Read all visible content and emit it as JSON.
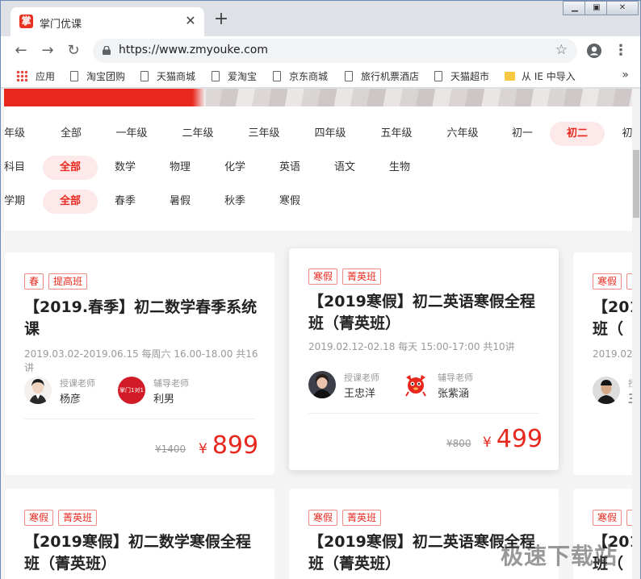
{
  "browser": {
    "tab_title": "掌门优课",
    "tab_logo_char": "掌",
    "url": "https://www.zmyouke.com",
    "bookmarks": {
      "apps": "应用",
      "items": [
        "淘宝团购",
        "天猫商城",
        "爱淘宝",
        "京东商城",
        "旅行机票酒店",
        "天猫超市"
      ],
      "import": "从 IE 中导入"
    }
  },
  "filters": {
    "grade": {
      "label": "年级",
      "options": [
        "全部",
        "一年级",
        "二年级",
        "三年级",
        "四年级",
        "五年级",
        "六年级",
        "初一",
        "初二",
        "初"
      ],
      "selected": "初二"
    },
    "subject": {
      "label": "科目",
      "options": [
        "全部",
        "数学",
        "物理",
        "化学",
        "英语",
        "语文",
        "生物"
      ],
      "selected": "全部"
    },
    "term": {
      "label": "学期",
      "options": [
        "全部",
        "春季",
        "暑假",
        "秋季",
        "寒假"
      ],
      "selected": "全部"
    }
  },
  "courses": [
    {
      "tags": [
        "春",
        "提高班"
      ],
      "title": "【2019.春季】初二数学春季系统课",
      "schedule": "2019.03.02-2019.06.15 每周六 16.00-18.00  共16讲",
      "lecturer_role": "授课老师",
      "lecturer": "杨彦",
      "tutor_role": "辅导老师",
      "tutor": "利男",
      "old_price": "¥1400",
      "currency": "¥",
      "price": "899"
    },
    {
      "tags": [
        "寒假",
        "菁英班"
      ],
      "title": "【2019寒假】初二英语寒假全程班（菁英班）",
      "schedule": "2019.02.12-02.18 每天 15:00-17:00  共10讲",
      "lecturer_role": "授课老师",
      "lecturer": "王忠洋",
      "tutor_role": "辅导老师",
      "tutor": "张紫涵",
      "old_price": "¥800",
      "currency": "¥",
      "price": "499"
    },
    {
      "tags": [
        "寒假",
        ""
      ],
      "title": "【201",
      "title2": "班（",
      "schedule": "2019.02.",
      "lecturer_role": "授",
      "lecturer": "王"
    },
    {
      "tags": [
        "寒假",
        "菁英班"
      ],
      "title": "【2019寒假】初二数学寒假全程班（菁英班）"
    },
    {
      "tags": [
        "寒假",
        "菁英班"
      ],
      "title": "【2019寒假】初二英语寒假全程班（菁英班）"
    },
    {
      "tags": [
        "寒假",
        ""
      ],
      "title": "【201",
      "title2": "班（"
    }
  ],
  "tutor_logo_text": "掌门1对1",
  "watermark": "极速下载站"
}
